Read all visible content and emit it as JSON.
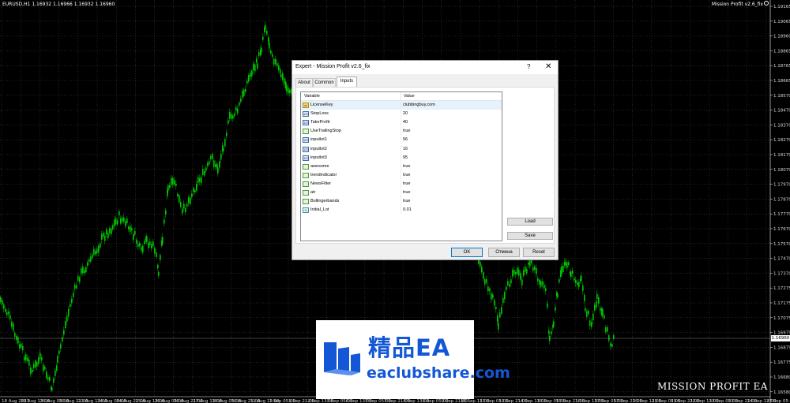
{
  "chart": {
    "info": "EURUSD,H1  1.16932 1.16966 1.16932 1.16960",
    "ea_label": "Mission Profit v2.6_fix",
    "current_price": "1.16960",
    "watermark": "MISSION PROFIT EA",
    "price_labels": [
      "1.19165",
      "1.19065",
      "1.18960",
      "1.18865",
      "1.18765",
      "1.18665",
      "1.18570",
      "1.18470",
      "1.18370",
      "1.18270",
      "1.18170",
      "1.18070",
      "1.17970",
      "1.17870",
      "1.17770",
      "1.17670",
      "1.17570",
      "1.17470",
      "1.17370",
      "1.17275",
      "1.17175",
      "1.17075",
      "1.16975",
      "1.16875",
      "1.16775",
      "1.16680",
      "1.16580"
    ],
    "time_labels": [
      "18 Aug 2021",
      "19 Aug 13:00",
      "20 Aug 05:00",
      "20 Aug 21:00",
      "23 Aug 13:00",
      "24 Aug 05:00",
      "24 Aug 21:00",
      "25 Aug 13:00",
      "26 Aug 05:00",
      "26 Aug 21:00",
      "27 Aug 13:00",
      "30 Aug 05:00",
      "30 Aug 21:00",
      "31 Aug 13:00",
      "1 Sep 05:00",
      "1 Sep 21:00",
      "2 Sep 13:00",
      "3 Sep 05:00",
      "6 Sep 13:00",
      "7 Sep 05:00",
      "7 Sep 21:00",
      "8 Sep 13:00",
      "9 Sep 05:00",
      "9 Sep 21:00",
      "10 Sep 13:00",
      "13 Sep 05:00",
      "13 Sep 21:00",
      "14 Sep 13:00",
      "15 Sep 05:00",
      "15 Sep 21:00",
      "16 Sep 13:00",
      "17 Sep 05:00",
      "17 Sep 21:00",
      "20 Sep 13:00",
      "21 Sep 05:00",
      "21 Sep 21:00",
      "22 Sep 13:00",
      "23 Sep 05:00",
      "23 Sep 21:00",
      "24 Sep 13:00",
      "27 Sep 05:00"
    ],
    "candle_color": "#00c800"
  },
  "dialog": {
    "title": "Expert - Mission Profit v2.6_fix",
    "help": "?",
    "close": "✕",
    "tabs": [
      "About",
      "Common",
      "Inputs"
    ],
    "active_tab": "Inputs",
    "columns": [
      "Variable",
      "Value"
    ],
    "inputs": [
      {
        "icon": "ab",
        "name": "LicenseKey",
        "value": "clubbingbuy.com"
      },
      {
        "icon": "123",
        "name": "StopLoss",
        "value": "20"
      },
      {
        "icon": "123",
        "name": "TakeProfit",
        "value": "40"
      },
      {
        "icon": "bool",
        "name": "UseTrailingStop",
        "value": "true"
      },
      {
        "icon": "123",
        "name": "inputlot1",
        "value": "56"
      },
      {
        "icon": "123",
        "name": "inputlot2",
        "value": "16"
      },
      {
        "icon": "123",
        "name": "inputlot3",
        "value": "95"
      },
      {
        "icon": "bool",
        "name": "awesome",
        "value": "true"
      },
      {
        "icon": "bool",
        "name": "trendindicator",
        "value": "true"
      },
      {
        "icon": "bool",
        "name": "NewsFilter",
        "value": "true"
      },
      {
        "icon": "bool",
        "name": "atr",
        "value": "true"
      },
      {
        "icon": "bool",
        "name": "Bollingerbands",
        "value": "true"
      },
      {
        "icon": "dbl",
        "name": "Initial_Lot",
        "value": "0.01"
      }
    ],
    "load_label": "Load",
    "save_label": "Save",
    "ok_label": "OK",
    "cancel_label": "Отмена",
    "reset_label": "Reset"
  },
  "logo": {
    "title": "精品EA",
    "url": "eaclubshare.com",
    "color": "#1457d6"
  }
}
